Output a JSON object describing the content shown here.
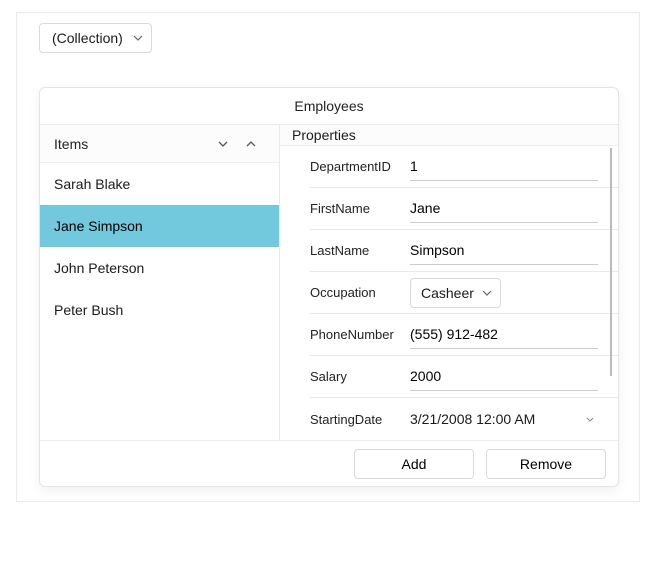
{
  "collection_dropdown": {
    "label": "(Collection)"
  },
  "editor": {
    "title": "Employees",
    "items_header": "Items",
    "properties_header": "Properties",
    "items": [
      {
        "name": "Sarah Blake",
        "selected": false
      },
      {
        "name": "Jane Simpson",
        "selected": true
      },
      {
        "name": "John Peterson",
        "selected": false
      },
      {
        "name": "Peter Bush",
        "selected": false
      }
    ],
    "properties": {
      "department_id": {
        "label": "DepartmentID",
        "value": "1"
      },
      "first_name": {
        "label": "FirstName",
        "value": "Jane"
      },
      "last_name": {
        "label": "LastName",
        "value": "Simpson"
      },
      "occupation": {
        "label": "Occupation",
        "value": "Casheer"
      },
      "phone_number": {
        "label": "PhoneNumber",
        "value": "(555) 912-482"
      },
      "salary": {
        "label": "Salary",
        "value": "2000"
      },
      "starting_date": {
        "label": "StartingDate",
        "value": "3/21/2008 12:00 AM"
      }
    },
    "buttons": {
      "add": "Add",
      "remove": "Remove"
    }
  }
}
